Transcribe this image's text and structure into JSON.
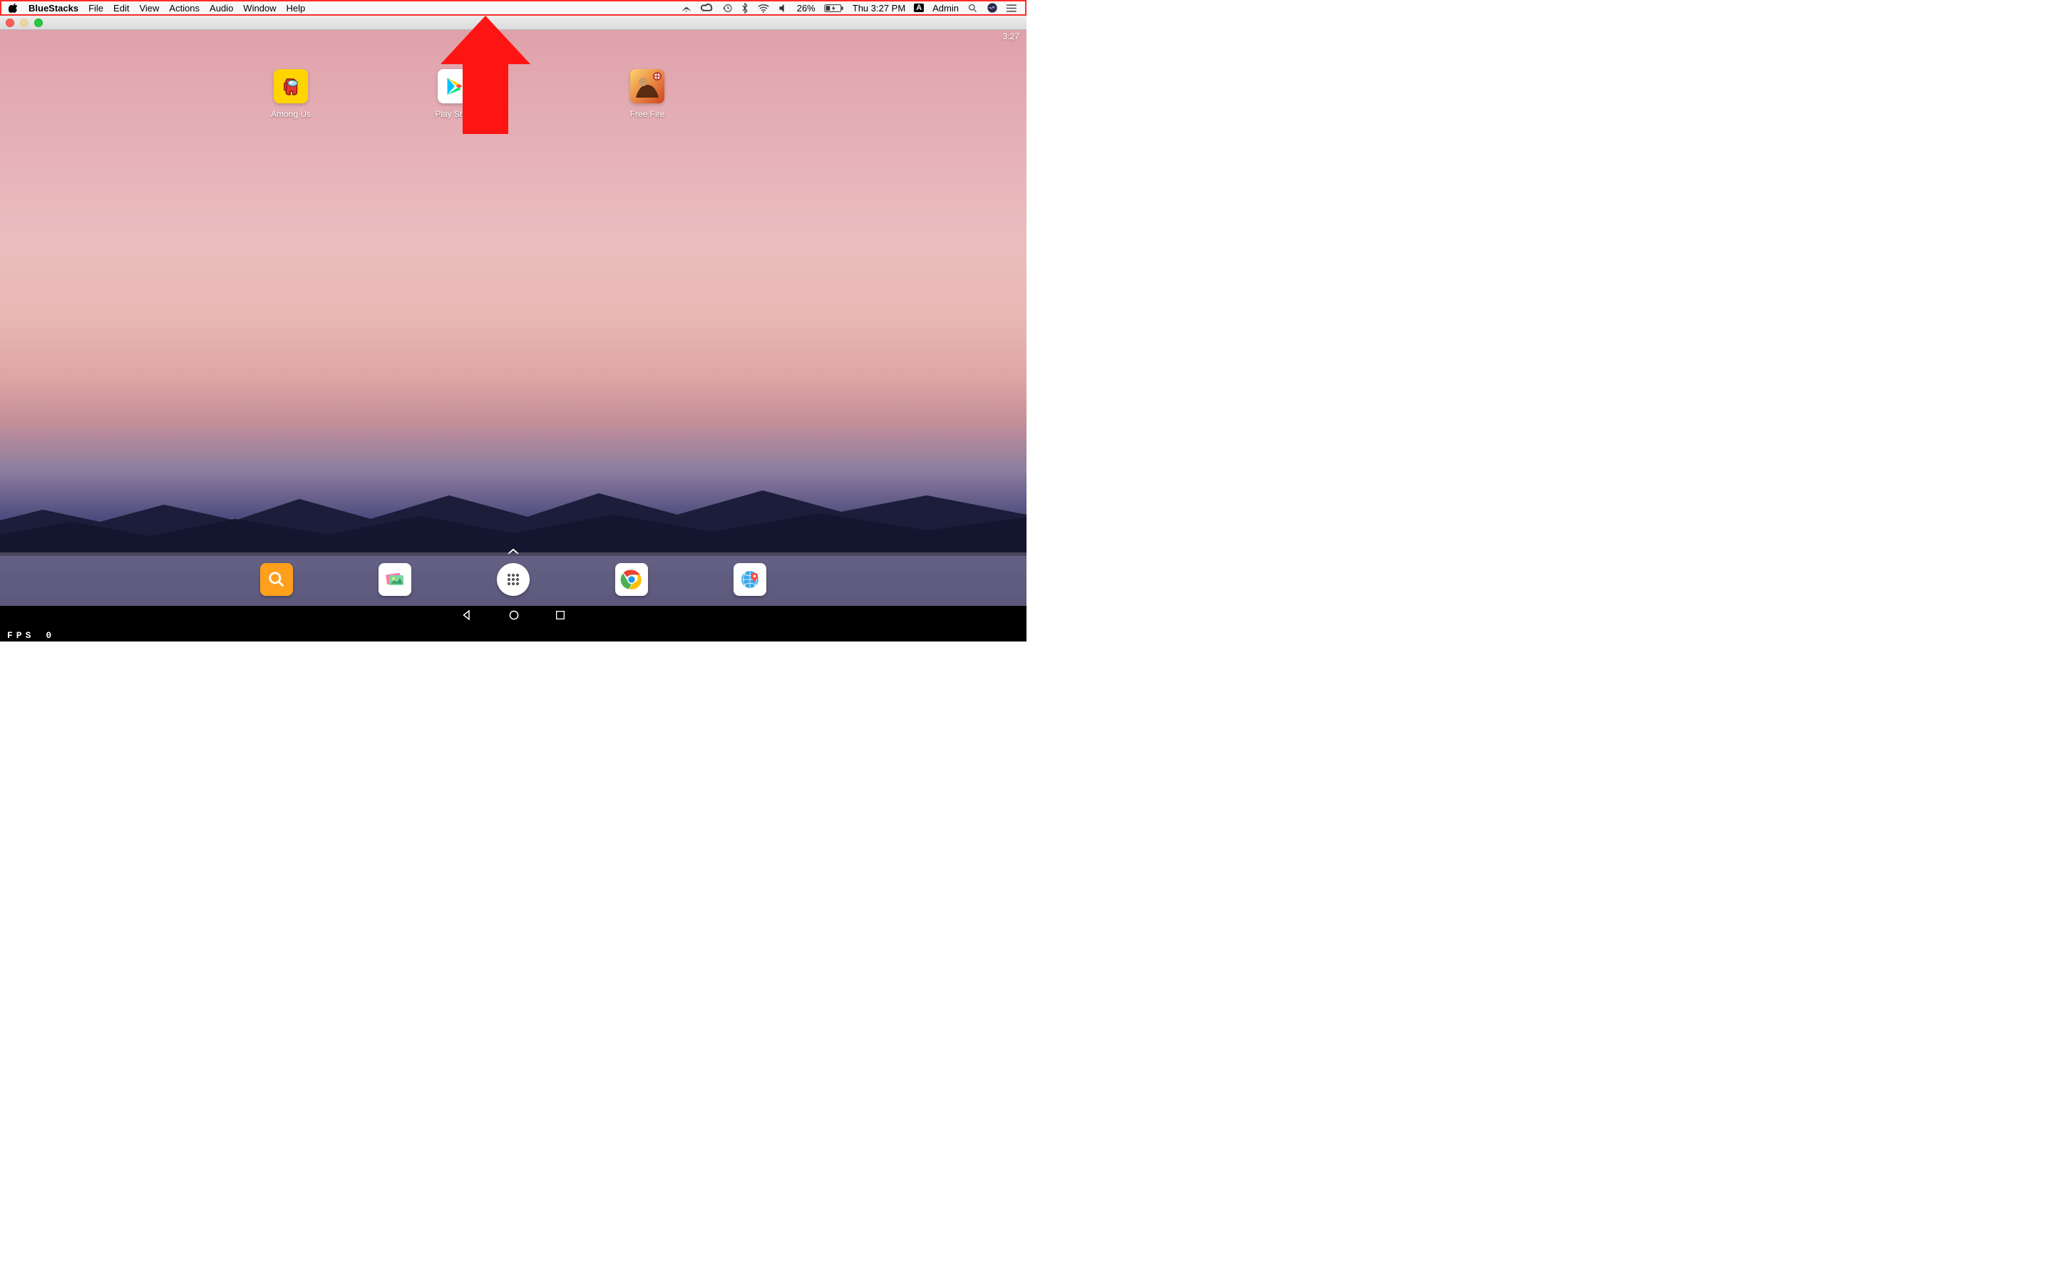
{
  "menubar": {
    "app_name": "BlueStacks",
    "items": [
      "File",
      "Edit",
      "View",
      "Actions",
      "Audio",
      "Window",
      "Help"
    ],
    "right": {
      "battery_percent": "26%",
      "clock": "Thu 3:27 PM",
      "keyboard_badge": "A",
      "user": "Admin"
    }
  },
  "android": {
    "status_time": "3:27",
    "apps": [
      {
        "label": "Among Us",
        "bg": "#ffd400"
      },
      {
        "label": "Play Store",
        "bg": "#ffffff"
      },
      {
        "label": "Free Fire",
        "bg": "#e86a1c"
      }
    ],
    "dock": [
      {
        "name": "search",
        "bg": "#ff9f1c"
      },
      {
        "name": "gallery",
        "bg": "#ffffff"
      },
      {
        "name": "apps-drawer",
        "bg": "#ffffff"
      },
      {
        "name": "chrome",
        "bg": "#ffffff"
      },
      {
        "name": "map",
        "bg": "#ffffff"
      }
    ],
    "fps_label": "FPS",
    "fps_value": "0"
  }
}
